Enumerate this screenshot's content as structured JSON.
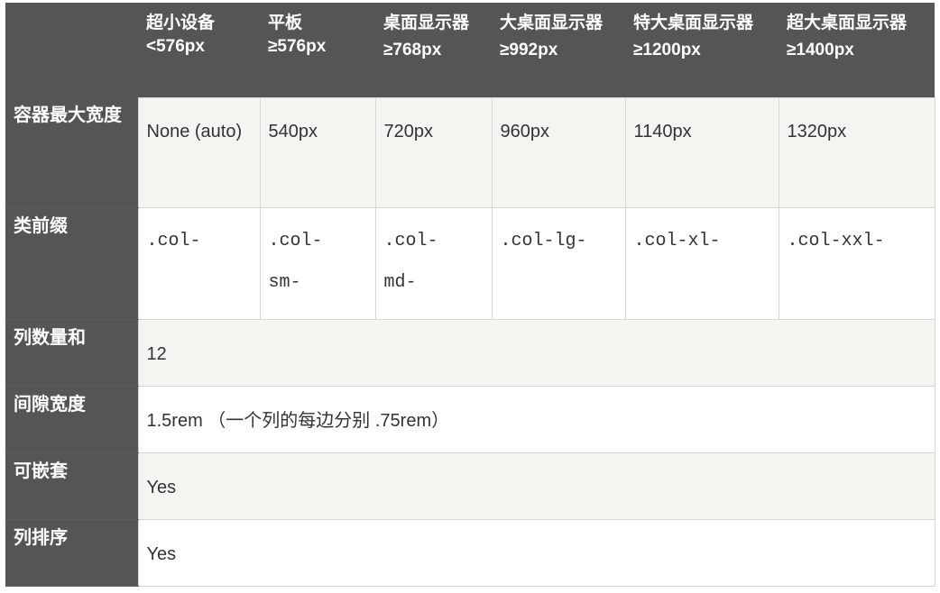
{
  "headers": [
    {
      "name": "超小设备",
      "size": "<576px"
    },
    {
      "name": "平板",
      "size": "≥576px"
    },
    {
      "name": "桌面显示器",
      "size": "≥768px"
    },
    {
      "name": "大桌面显示器",
      "size": "≥992px"
    },
    {
      "name": "特大桌面显示器",
      "size": "≥1200px"
    },
    {
      "name": "超大桌面显示器",
      "size": "≥1400px"
    }
  ],
  "rows": {
    "container": {
      "label": "容器最大宽度",
      "values": [
        "None (auto)",
        "540px",
        "720px",
        "960px",
        "1140px",
        "1320px"
      ]
    },
    "prefix": {
      "label": "类前缀",
      "values": [
        ".col-",
        ".col-sm-",
        ".col-md-",
        ".col-lg-",
        ".col-xl-",
        ".col-xxl-"
      ]
    },
    "columns": {
      "label": "列数量和",
      "value": "12"
    },
    "gutter": {
      "label": "间隙宽度",
      "value": "1.5rem （一个列的每边分别 .75rem）"
    },
    "nestable": {
      "label": "可嵌套",
      "value": "Yes"
    },
    "ordering": {
      "label": "列排序",
      "value": "Yes"
    }
  }
}
